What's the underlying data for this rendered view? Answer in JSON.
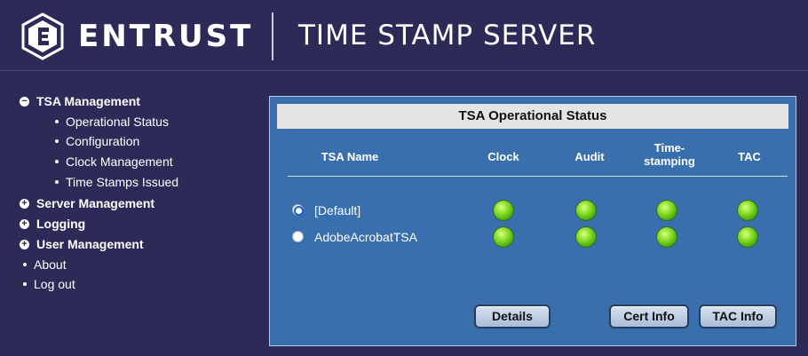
{
  "header": {
    "brand": "ENTRUST",
    "app_title": "TIME STAMP SERVER",
    "logo_icon": "entrust-shield-logo"
  },
  "sidebar": {
    "tsa_management": {
      "label": "TSA Management",
      "icon": "minus-circle-icon",
      "items": [
        {
          "label": "Operational Status"
        },
        {
          "label": "Configuration"
        },
        {
          "label": "Clock Management"
        },
        {
          "label": "Time Stamps Issued"
        }
      ]
    },
    "server_management": {
      "label": "Server Management",
      "icon": "plus-circle-icon"
    },
    "logging": {
      "label": "Logging",
      "icon": "plus-circle-icon"
    },
    "user_management": {
      "label": "User Management",
      "icon": "plus-circle-icon"
    },
    "about": {
      "label": "About"
    },
    "logout": {
      "label": "Log out"
    }
  },
  "panel": {
    "title": "TSA Operational Status",
    "columns": {
      "name": "TSA Name",
      "clock": "Clock",
      "audit": "Audit",
      "timestamping_1": "Time-",
      "timestamping_2": "stamping",
      "tac": "TAC"
    },
    "rows": [
      {
        "name": "[Default]",
        "selected": true,
        "clock": "green",
        "audit": "green",
        "timestamping": "green",
        "tac": "green"
      },
      {
        "name": "AdobeAcrobatTSA",
        "selected": false,
        "clock": "green",
        "audit": "green",
        "timestamping": "green",
        "tac": "green"
      }
    ],
    "buttons": {
      "details": "Details",
      "cert_info": "Cert Info",
      "tac_info": "TAC Info"
    }
  },
  "colors": {
    "background": "#2e2a58",
    "panel": "#3a6fae",
    "status_ok": "#6fd11f"
  }
}
